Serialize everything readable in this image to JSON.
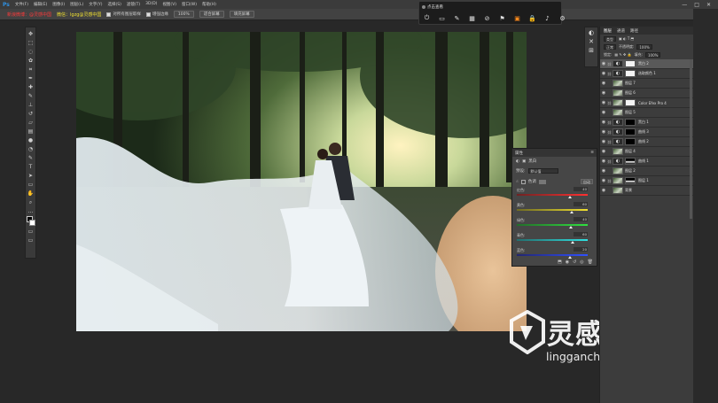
{
  "app": {
    "logo": "Ps",
    "menu": [
      "文件(F)",
      "编辑(E)",
      "图像(I)",
      "图层(L)",
      "文字(Y)",
      "选择(S)",
      "滤镜(T)",
      "3D(D)",
      "视图(V)",
      "窗口(W)",
      "帮助(H)"
    ],
    "window_controls": [
      "—",
      "□",
      "✕"
    ]
  },
  "options_bar": {
    "red_text": "新浪微博：@灵感中国",
    "yellow_text": "微信：lgzg@灵感中国",
    "sample_all_label": "对所有图层取样",
    "sample_all_checked": true,
    "enhance_edge_label": "增强边缘",
    "enhance_edge_checked": true,
    "zoom_value": "100%",
    "fit_screen": "适合屏幕",
    "fill_screen": "填充屏幕"
  },
  "float_toolbar": {
    "title": "点击查看",
    "icons": [
      "power-icon",
      "chat-icon",
      "pen-icon",
      "gift-icon",
      "pen-slash-icon",
      "flag-icon",
      "camera-icon",
      "lock-icon",
      "bell-icon",
      "gear-icon"
    ],
    "active_icon": "camera-icon"
  },
  "tools": [
    "move-icon",
    "marquee-icon",
    "lasso-icon",
    "quick-select-icon",
    "crop-icon",
    "eyedropper-icon",
    "healing-icon",
    "brush-icon",
    "stamp-icon",
    "history-brush-icon",
    "eraser-icon",
    "gradient-icon",
    "blur-icon",
    "dodge-icon",
    "pen-icon",
    "type-icon",
    "path-select-icon",
    "shape-icon",
    "hand-icon",
    "zoom-icon",
    "more-icon"
  ],
  "properties": {
    "tab": "属性",
    "adjustment_name": "黑白",
    "preset_label": "预设:",
    "preset_value": "默认值",
    "tint_label": "色调",
    "auto_label": "自动",
    "sliders": [
      {
        "label": "红色:",
        "value": "40",
        "pos": 0.72,
        "gradient": [
          "#6e2323",
          "#ff3030"
        ]
      },
      {
        "label": "黄色:",
        "value": "60",
        "pos": 0.75,
        "gradient": [
          "#6e6a23",
          "#f0e030"
        ]
      },
      {
        "label": "绿色:",
        "value": "40",
        "pos": 0.74,
        "gradient": [
          "#236e2a",
          "#30e040"
        ]
      },
      {
        "label": "青色:",
        "value": "60",
        "pos": 0.76,
        "gradient": [
          "#236e6e",
          "#30e0e0"
        ]
      },
      {
        "label": "蓝色:",
        "value": "20",
        "pos": 0.72,
        "gradient": [
          "#23266e",
          "#3050ff"
        ]
      }
    ]
  },
  "layers_panel": {
    "tabs": [
      "图层",
      "通道",
      "路径"
    ],
    "active_tab": "图层",
    "kind_label": "类型",
    "blend_mode": "正常",
    "opacity_label": "不透明度:",
    "opacity_value": "100%",
    "lock_label": "锁定:",
    "fill_label": "填充:",
    "fill_value": "100%",
    "layers": [
      {
        "name": "黑白 2",
        "thumb": "adjust",
        "mask": "white",
        "selected": true
      },
      {
        "name": "选取颜色 1",
        "thumb": "adjust",
        "mask": "white",
        "selected": false
      },
      {
        "name": "图层 7",
        "thumb": "photo",
        "mask": "",
        "selected": false
      },
      {
        "name": "图层 6",
        "thumb": "photo",
        "mask": "",
        "selected": false
      },
      {
        "name": "Color Efex Pro 4",
        "thumb": "photo",
        "mask": "white",
        "selected": false
      },
      {
        "name": "图层 5",
        "thumb": "photo",
        "mask": "",
        "selected": false
      },
      {
        "name": "黑白 1",
        "thumb": "adjust",
        "mask": "black",
        "selected": false
      },
      {
        "name": "曲线 3",
        "thumb": "adjust",
        "mask": "black",
        "selected": false
      },
      {
        "name": "曲线 2",
        "thumb": "adjust",
        "mask": "black",
        "selected": false
      },
      {
        "name": "图层 4",
        "thumb": "photo",
        "mask": "",
        "selected": false
      },
      {
        "name": "曲线 1",
        "thumb": "adjust",
        "mask": "shape",
        "selected": false
      },
      {
        "name": "图层 2",
        "thumb": "photo",
        "mask": "",
        "selected": false
      },
      {
        "name": "图层 1",
        "thumb": "photo",
        "mask": "shape",
        "selected": false
      },
      {
        "name": "背景",
        "thumb": "photo",
        "mask": "",
        "selected": false
      }
    ]
  },
  "watermark": {
    "chinese": "灵感中国",
    "url": "lingganchina.com",
    "reg": "®"
  },
  "colors": {
    "ui_bg": "#282828",
    "panel": "#3c3c3c",
    "accent_orange": "#ff8a1c",
    "ps_blue": "#2f8fe0"
  }
}
